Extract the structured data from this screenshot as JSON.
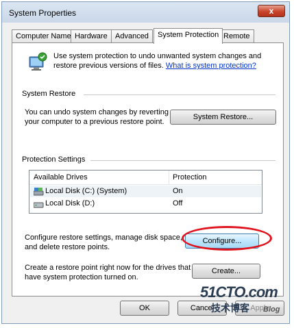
{
  "window": {
    "title": "System Properties",
    "close_glyph": "x"
  },
  "tabs": [
    {
      "label": "Computer Name"
    },
    {
      "label": "Hardware"
    },
    {
      "label": "Advanced"
    },
    {
      "label": "System Protection"
    },
    {
      "label": "Remote"
    }
  ],
  "intro": {
    "text": "Use system protection to undo unwanted system changes and restore previous versions of files.",
    "link": "What is system protection?",
    "icon": "system-protection-icon"
  },
  "system_restore": {
    "heading": "System Restore",
    "description": "You can undo system changes by reverting your computer to a previous restore point.",
    "button": "System Restore..."
  },
  "protection_settings": {
    "heading": "Protection Settings",
    "columns": [
      "Available Drives",
      "Protection"
    ],
    "drives": [
      {
        "name": "Local Disk (C:) (System)",
        "protection": "On",
        "icon": "system-drive-icon"
      },
      {
        "name": "Local Disk (D:)",
        "protection": "Off",
        "icon": "drive-icon"
      }
    ],
    "configure_text": "Configure restore settings, manage disk space, and delete restore points.",
    "configure_button": "Configure...",
    "create_text": "Create a restore point right now for the drives that have system protection turned on.",
    "create_button": "Create..."
  },
  "footer": {
    "ok": "OK",
    "cancel": "Cancel",
    "apply": "Apply"
  },
  "watermark": {
    "main": "51CTO.com",
    "sub": "技术博客",
    "blog": "Blog"
  },
  "colors": {
    "annotation": "#e0141e",
    "link": "#0033cc"
  }
}
